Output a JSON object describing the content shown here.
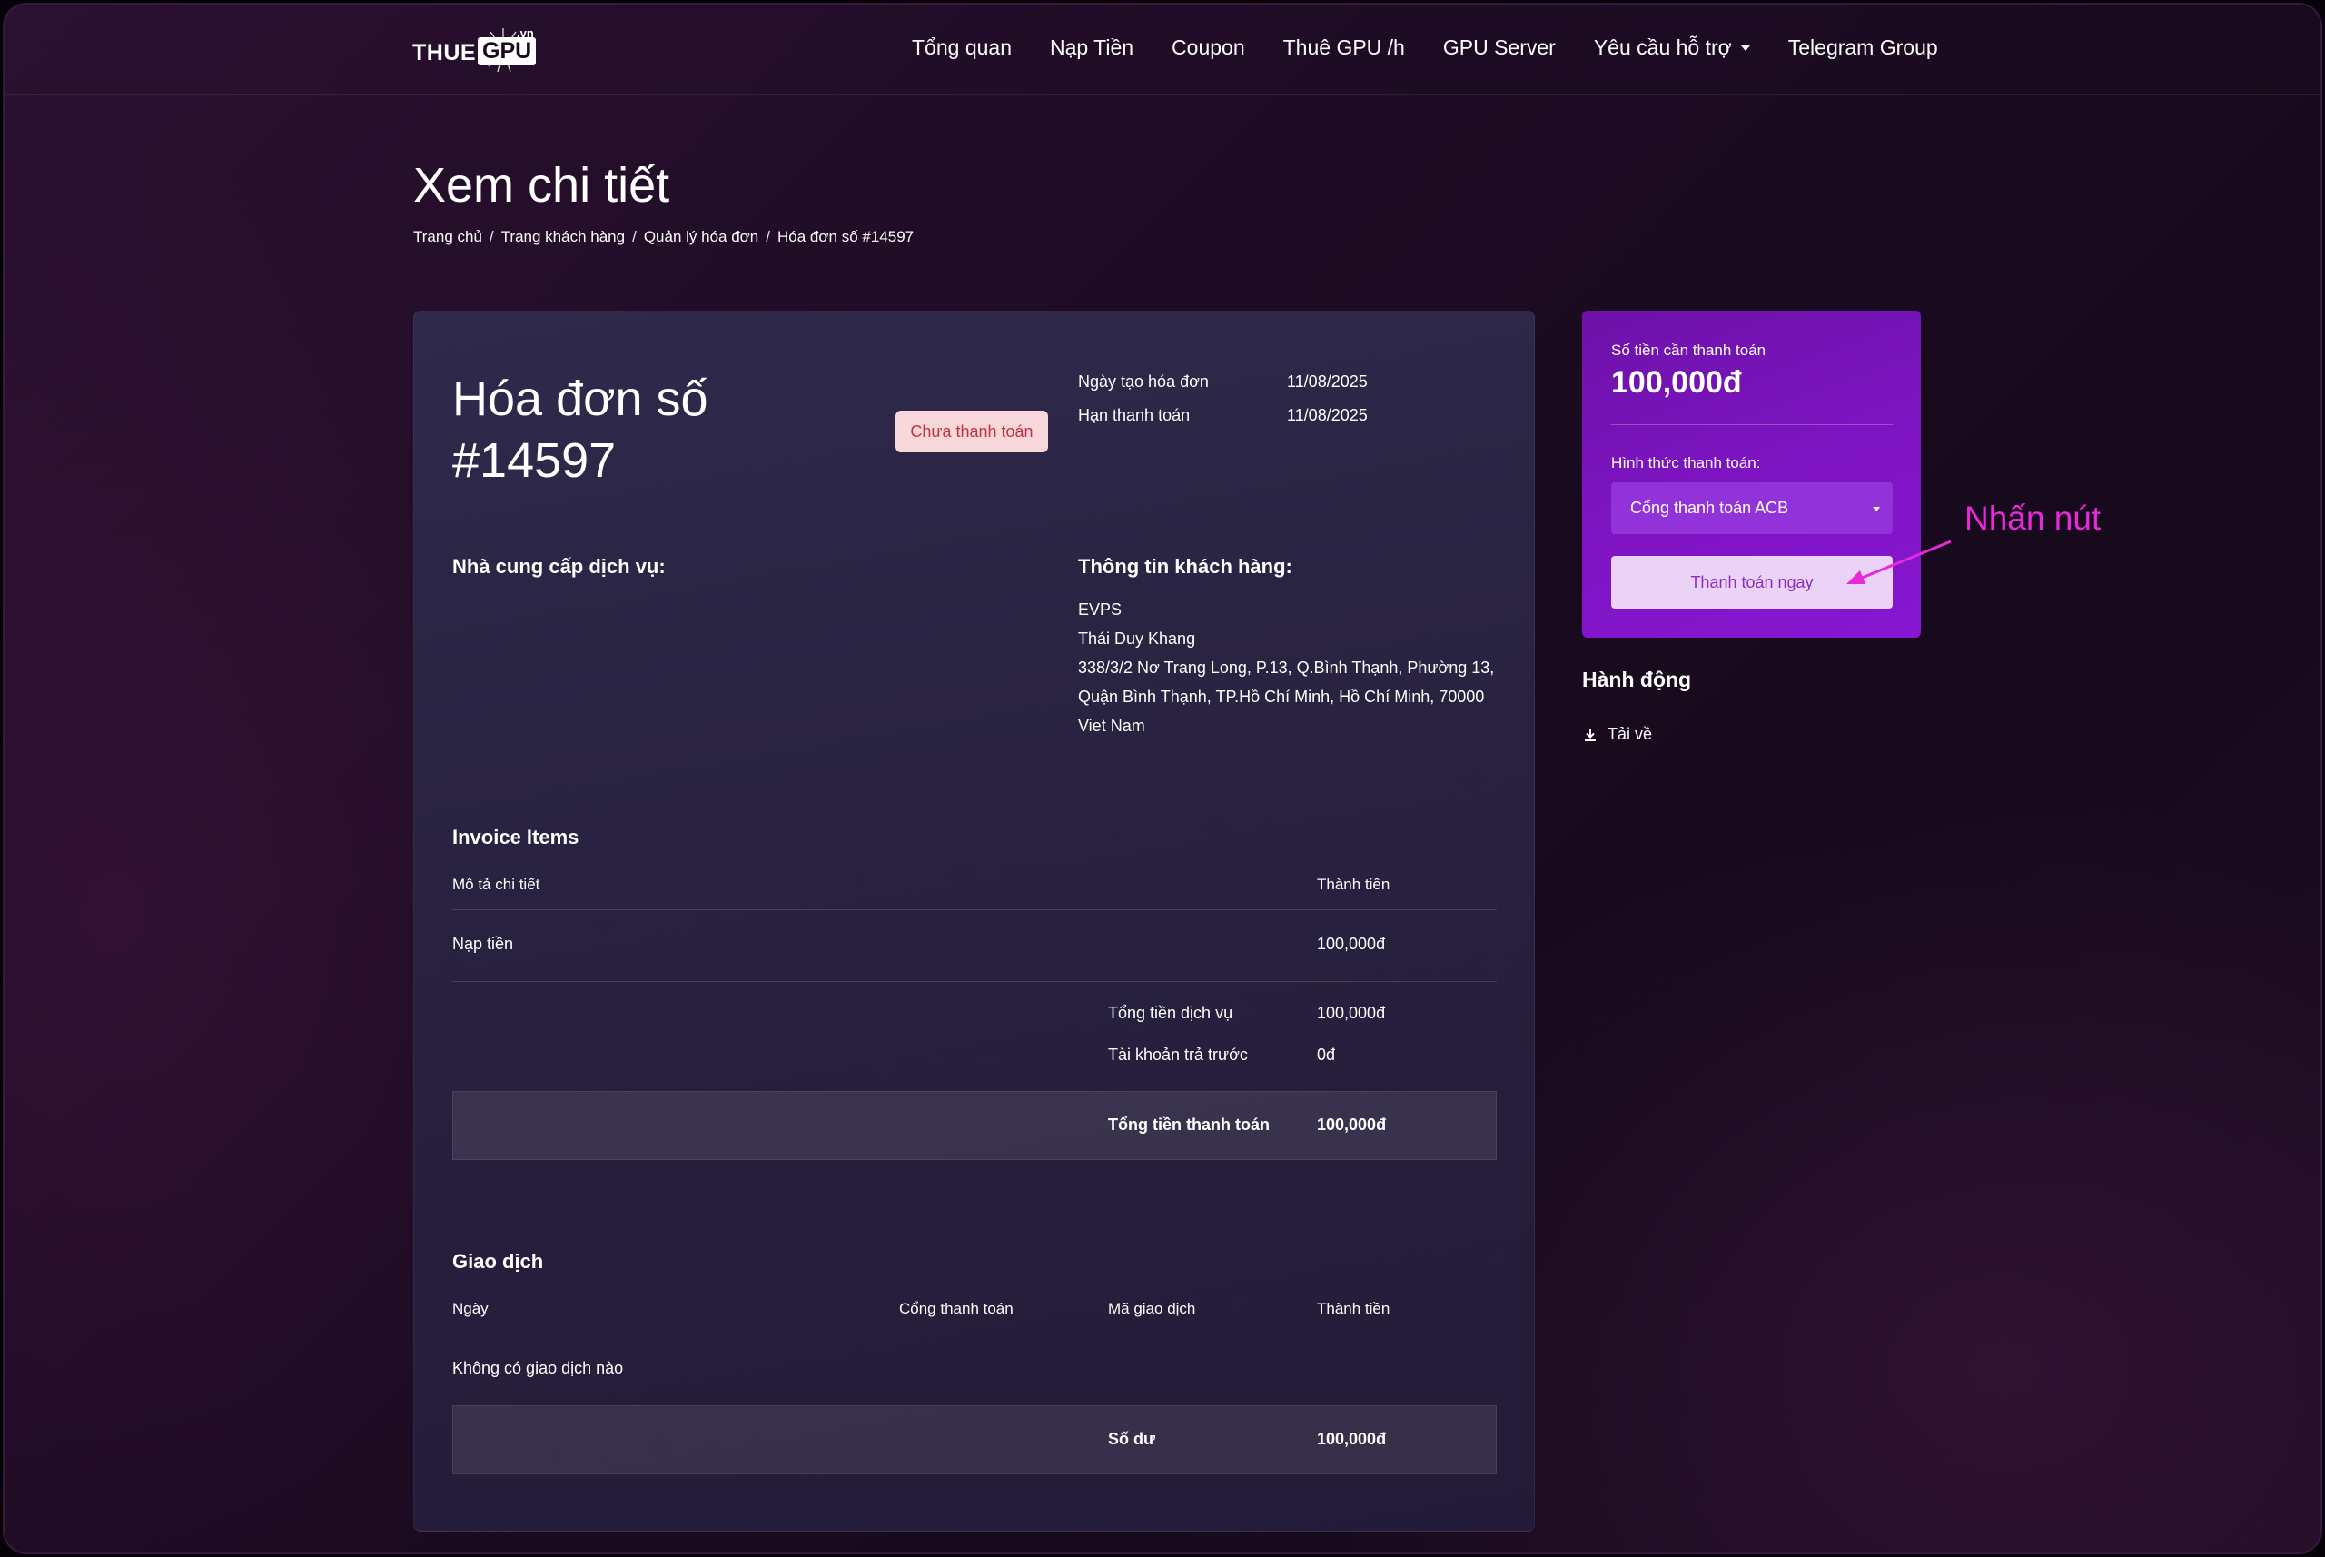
{
  "brand": {
    "name_part1": "THUE",
    "name_part2": "GPU",
    "tld": ".vn"
  },
  "nav": {
    "items": [
      "Tổng quan",
      "Nạp Tiền",
      "Coupon",
      "Thuê GPU /h",
      "GPU Server",
      "Yêu cầu hỗ trợ",
      "Telegram Group"
    ]
  },
  "header": {
    "title": "Xem chi tiết",
    "breadcrumb": [
      "Trang chủ",
      "Trang khách hàng",
      "Quản lý hóa đơn",
      "Hóa đơn số #14597"
    ],
    "separator": "/"
  },
  "invoice": {
    "title": "Hóa đơn số #14597",
    "status": "Chưa thanh toán",
    "created_label": "Ngày tạo hóa đơn",
    "created_value": "11/08/2025",
    "due_label": "Hạn thanh toán",
    "due_value": "11/08/2025",
    "provider_label": "Nhà cung cấp dịch vụ:",
    "customer_label": "Thông tin khách hàng:",
    "customer_company": "EVPS",
    "customer_name": "Thái Duy Khang",
    "customer_address": "338/3/2 Nơ Trang Long, P.13, Q.Bình Thạnh, Phường 13, Quận Bình Thạnh, TP.Hồ Chí Minh, Hồ Chí Minh, 70000",
    "customer_country": "Viet Nam",
    "items_label": "Invoice Items",
    "col_description": "Mô tả chi tiết",
    "col_amount": "Thành tiền",
    "items": [
      {
        "description": "Nạp tiền",
        "amount": "100,000đ"
      }
    ],
    "subtotal_label": "Tổng tiền dịch vụ",
    "subtotal_value": "100,000đ",
    "prepaid_label": "Tài khoản trả trước",
    "prepaid_value": "0đ",
    "total_label": "Tổng tiền thanh toán",
    "total_value": "100,000đ"
  },
  "transactions": {
    "label": "Giao dịch",
    "col_date": "Ngày",
    "col_gateway": "Cổng thanh toán",
    "col_txn_id": "Mã giao dịch",
    "col_amount": "Thành tiền",
    "empty_text": "Không có giao dịch nào",
    "balance_label": "Số dư",
    "balance_value": "100,000đ"
  },
  "payment": {
    "amount_label": "Số tiền cần thanh toán",
    "amount_value": "100,000đ",
    "method_label": "Hình thức thanh toán:",
    "method_selected": "Cổng thanh toán ACB",
    "pay_button": "Thanh toán ngay"
  },
  "annotation": {
    "text": "Nhấn nút",
    "color": "#e52ad8"
  },
  "actions": {
    "title": "Hành động",
    "download_label": "Tải về"
  },
  "colors": {
    "accent": "#8716d2",
    "status_bg": "#f8d7da",
    "status_text": "#c0323e",
    "pay_button_bg": "#ead3f7",
    "pay_button_text": "#8a2dc4"
  }
}
